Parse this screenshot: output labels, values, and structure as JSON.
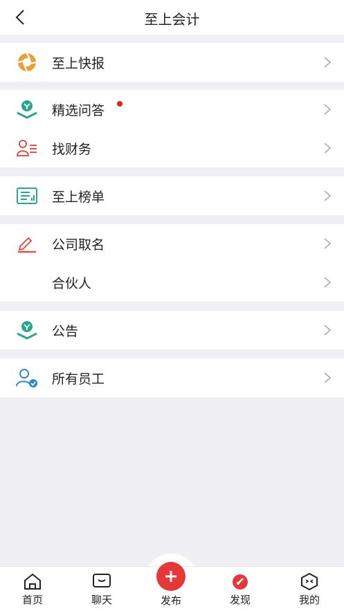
{
  "header": {
    "title": "至上会计"
  },
  "groups": [
    {
      "items": [
        {
          "label": "至上快报",
          "icon": "aperture-icon"
        }
      ]
    },
    {
      "items": [
        {
          "label": "精选问答",
          "icon": "reading-lamp-icon",
          "badge": true
        },
        {
          "label": "找财务",
          "icon": "person-list-icon"
        }
      ]
    },
    {
      "items": [
        {
          "label": "至上榜单",
          "icon": "chart-board-icon"
        }
      ]
    },
    {
      "items": [
        {
          "label": "公司取名",
          "icon": "pen-sign-icon"
        },
        {
          "label": "合伙人",
          "icon": ""
        }
      ]
    },
    {
      "items": [
        {
          "label": "公告",
          "icon": "reading-lamp-icon"
        }
      ]
    },
    {
      "items": [
        {
          "label": "所有员工",
          "icon": "person-check-icon"
        }
      ]
    }
  ],
  "tabbar": {
    "tabs": [
      {
        "label": "首页",
        "icon": "home-icon"
      },
      {
        "label": "聊天",
        "icon": "chat-icon"
      },
      {
        "label": "发布",
        "icon": "plus-icon"
      },
      {
        "label": "发现",
        "icon": "compass-icon"
      },
      {
        "label": "我的",
        "icon": "cube-face-icon"
      }
    ]
  },
  "colors": {
    "accent": "#e63838",
    "teal": "#2aa58a",
    "orange": "#e8a037",
    "red_icon": "#d9534f",
    "blue": "#2f86c8"
  }
}
